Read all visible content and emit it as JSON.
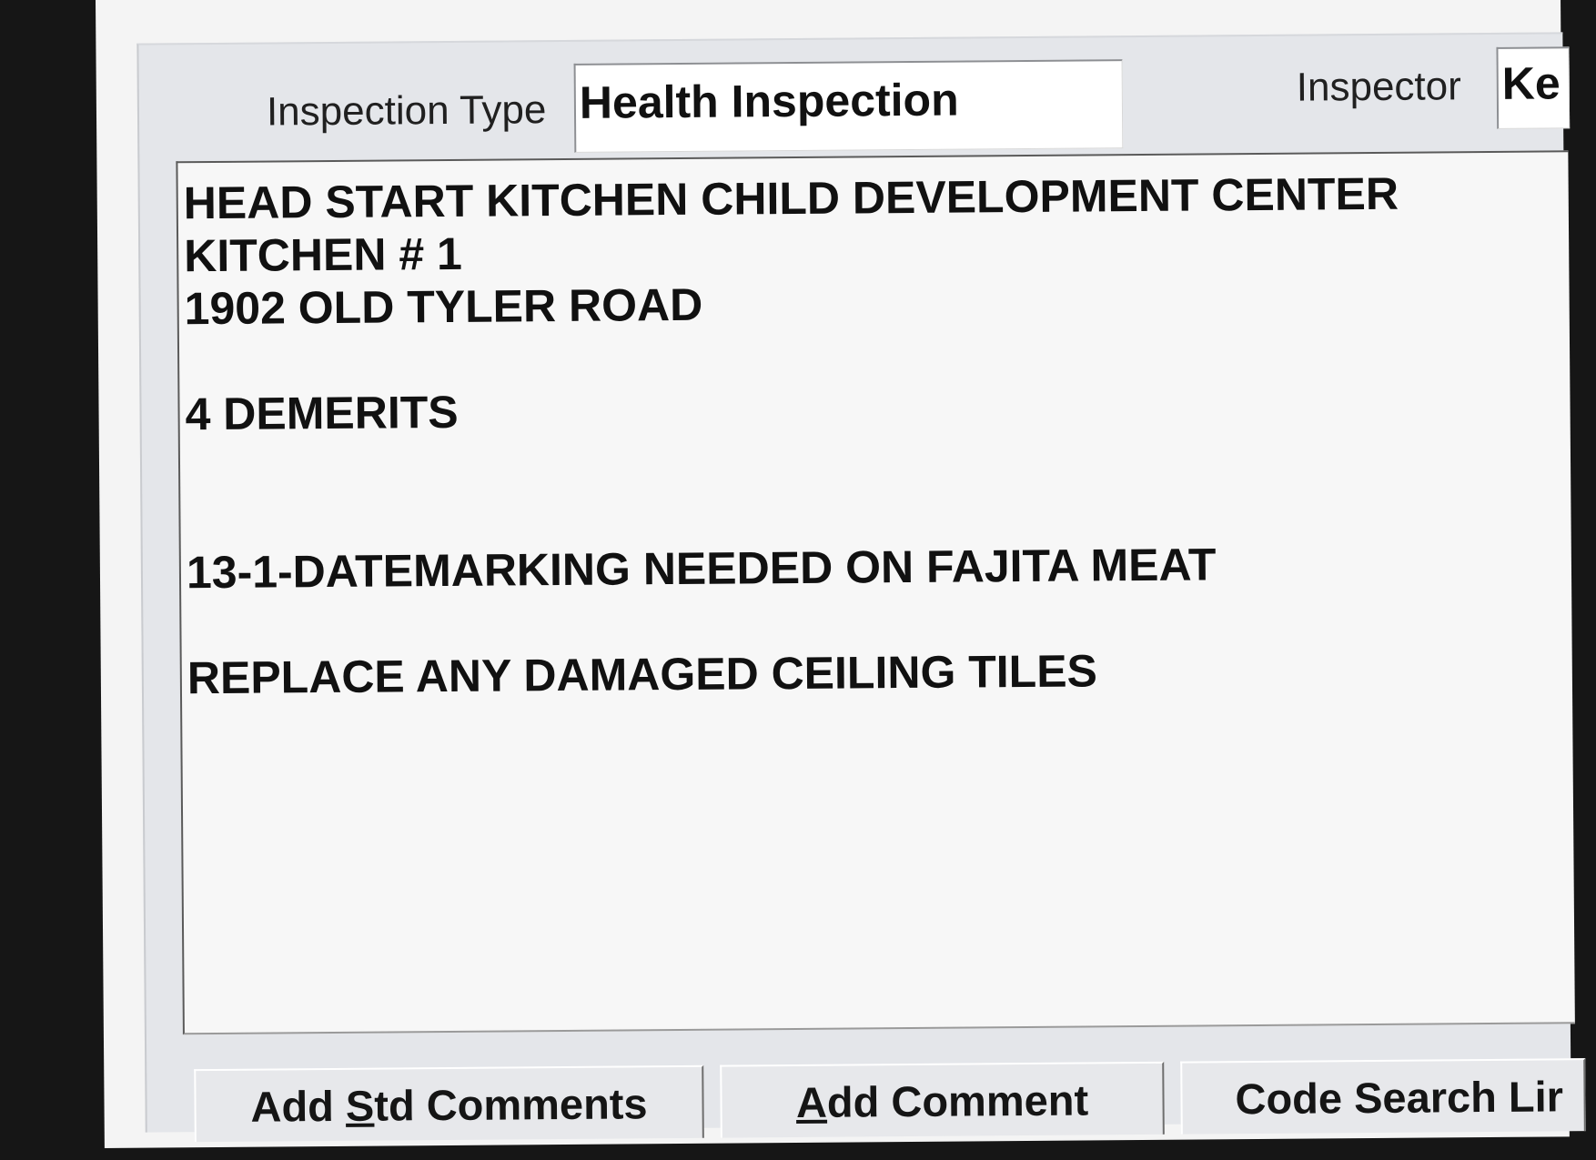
{
  "form": {
    "inspection_type_label": "Inspection Type",
    "inspection_type_value": "Health Inspection",
    "inspector_label": "Inspector",
    "inspector_value": "Ke"
  },
  "comments": {
    "lines": [
      "HEAD START KITCHEN CHILD DEVELOPMENT CENTER",
      "KITCHEN # 1",
      "1902 OLD TYLER ROAD",
      "",
      "4 DEMERITS",
      "",
      "",
      "13-1-DATEMARKING NEEDED ON FAJITA MEAT",
      "",
      "REPLACE ANY DAMAGED CEILING TILES"
    ]
  },
  "buttons": {
    "add_std_comments": {
      "pre": "Add ",
      "key": "S",
      "post": "td Comments"
    },
    "add_comment": {
      "pre": "",
      "key": "A",
      "post": "dd Comment"
    },
    "code_search": {
      "label": "Code Search Lir"
    }
  }
}
